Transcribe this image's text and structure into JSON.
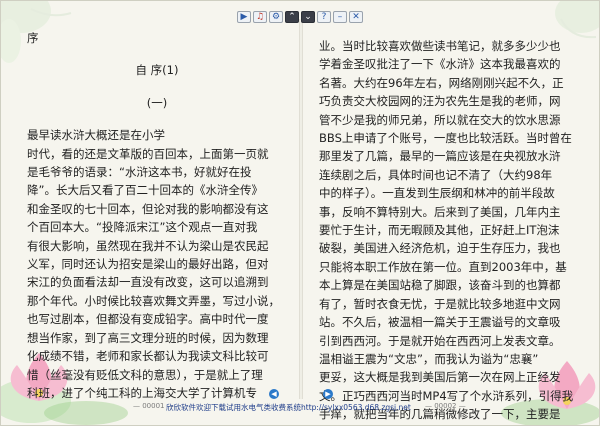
{
  "toolbar": {
    "buttons": [
      "play-icon",
      "music-icon",
      "settings-icon",
      "up-icon",
      "down-icon",
      "help-icon",
      "minimize-icon",
      "close-icon"
    ]
  },
  "left_page": {
    "lines": [
      "序",
      "自 序(1)",
      "(一)",
      "         最早读水浒大概还是在小学",
      "时代，看的还是文革版的百回本，上面第一页就",
      "是毛爷爷的语录：“水浒这本书，好就好在投",
      "降”。长大后又看了百二十回本的《水浒全传》",
      "和金圣叹的七十回本，但论对我的影响都没有这",
      "个百回本大。“投降派宋江”这个观点一直对我",
      "有很大影响，虽然现在我并不认为梁山是农民起",
      "义军，同时还认为招安是梁山的最好出路，但对",
      "宋江的负面看法却一直没有改变，这可以追溯到",
      "那个年代。小时候比较喜欢舞文弄墨，写过小说，",
      "也写过剧本，但都没有变成铅字。高中时代一度",
      "想当作家，到了高三文理分班的时候，因为数理",
      "化成绩不错，老师和家长都认为我读文科比较可",
      "惜（丝毫没有贬低文科的意思），于是就上了理",
      "科班，进了个纯工科的上海交大学了计算机专"
    ],
    "page_number": "— 00001 —"
  },
  "right_page": {
    "lines": [
      "业。当时比较喜欢做些读书笔记，就多多少少也",
      "学着金圣叹批注了一下《水浒》这本我最喜欢的",
      "名著。大约在96年左右，网络刚刚兴起不久，正",
      "巧负责交大校园网的汪为农先生是我的老师，网",
      "管不少是我的师兄弟，所以就在交大的饮水思源",
      "BBS上申请了个账号，一度也比较活跃。当时曾在",
      "那里发了几篇，最早的一篇应该是在央视放水浒",
      "连续剧之后，具体时间也记不清了（大约98年",
      "中的样子）。一直发到生辰纲和林冲的前半段故",
      "事，反响不算特别大。后来到了美国，几年内主",
      "要忙于生计，而无暇顾及其他，正好赶上IT泡沫",
      "破裂，美国进入经济危机，迫于生存压力，我也",
      "只能将本职工作放在第一位。直到2003年中，基",
      "本上算是在美国站稳了脚跟，该奋斗到的也算都",
      "有了，暂时衣食无忧，于是就比较多地逛中文网",
      "站。不久后，被温相一篇关于王震谥号的文章吸",
      "引到西西河。于是就开始在西西河上发表文章。",
      "温相谥王震为“文忠”，而我认为谥为“忠襄”",
      "更妥，这大概是我到美国后第一次在网上正经发",
      "文。正巧西西河当时MP4写了个水浒系列，引得我",
      "手痒，就把当年的几篇稍微修改了一下，主要是"
    ],
    "page_number": "— 00002 —"
  },
  "footer": {
    "promo_text": "欣欣软件欢迎下载试用水电气类收费系统http://sylxx0563.d68.zgsj.net"
  },
  "colors": {
    "page_bg": "#f6f5ee",
    "text": "#222222",
    "link": "#1f3d8a",
    "accent_blue": "#2b79c9"
  }
}
